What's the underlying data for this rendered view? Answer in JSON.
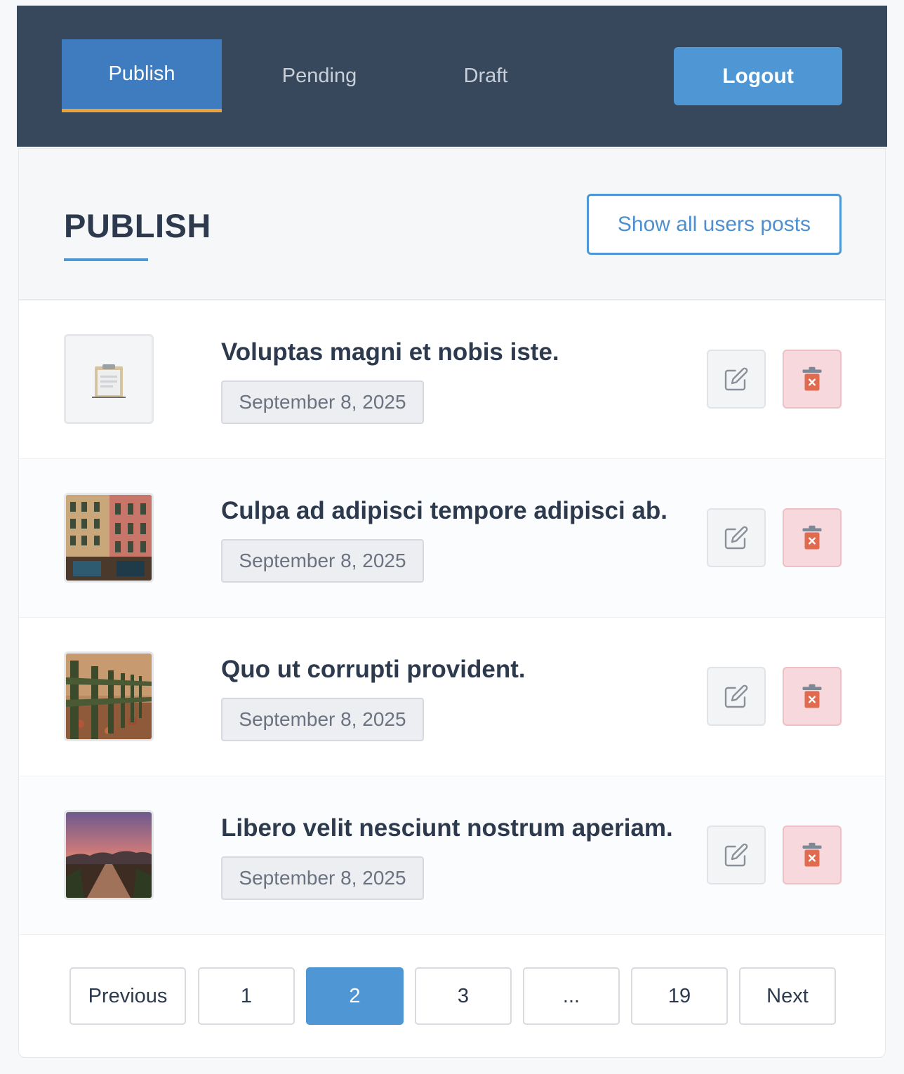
{
  "nav": {
    "tabs": [
      {
        "label": "Publish",
        "active": true
      },
      {
        "label": "Pending",
        "active": false
      },
      {
        "label": "Draft",
        "active": false
      }
    ],
    "logout_label": "Logout"
  },
  "header": {
    "title": "PUBLISH",
    "show_all_label": "Show all users posts"
  },
  "posts": [
    {
      "title": "Voluptas magni et nobis iste.",
      "date": "September 8, 2025",
      "thumbnail": "clipboard-placeholder-icon"
    },
    {
      "title": "Culpa ad adipisci tempore adipisci ab.",
      "date": "September 8, 2025",
      "thumbnail": "building-facade-photo"
    },
    {
      "title": "Quo ut corrupti provident.",
      "date": "September 8, 2025",
      "thumbnail": "wooden-fence-autumn-photo"
    },
    {
      "title": "Libero velit nesciunt nostrum aperiam.",
      "date": "September 8, 2025",
      "thumbnail": "sunset-path-photo"
    }
  ],
  "pagination": {
    "previous_label": "Previous",
    "pages": [
      "1",
      "2",
      "3",
      "...",
      "19"
    ],
    "current_page": "2",
    "next_label": "Next"
  },
  "colors": {
    "navbar_bg": "#37475c",
    "accent_blue": "#4e97d4",
    "active_tab_bg": "#3e7cbf",
    "active_tab_underline": "#e8a33c",
    "delete_bg": "#f7d8dc",
    "delete_icon": "#e06b4f"
  }
}
